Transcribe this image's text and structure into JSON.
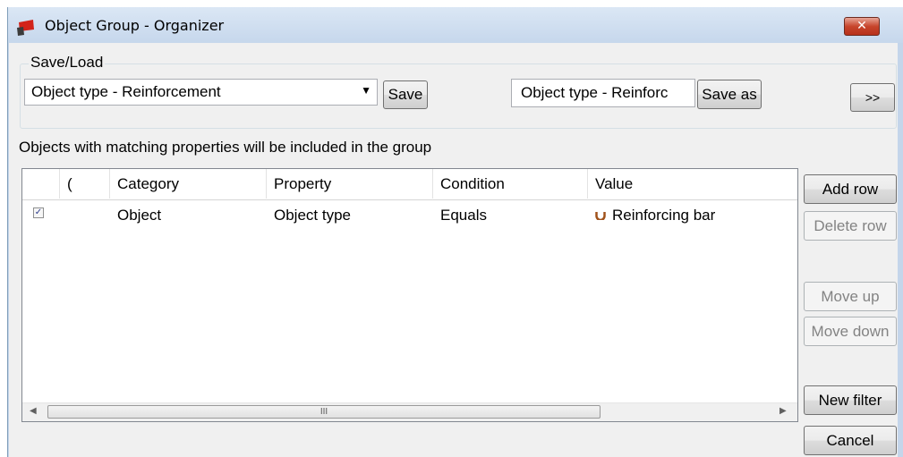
{
  "window": {
    "title": "Object Group - Organizer",
    "close_label": "✕"
  },
  "save_load": {
    "legend": "Save/Load",
    "combo_value": "Object type - Reinforcement",
    "save_label": "Save",
    "saveas_value": "Object type - Reinforc",
    "saveas_label": "Save as",
    "expand_label": ">>"
  },
  "caption": "Objects with matching properties will be included in the group",
  "grid": {
    "columns": [
      "",
      "(",
      "Category",
      "Property",
      "Condition",
      "Value"
    ],
    "rows": [
      {
        "checked": true,
        "paren": "",
        "category": "Object",
        "property": "Object type",
        "condition": "Equals",
        "value": "Reinforcing bar",
        "value_icon": "reinforcing-bar-icon"
      }
    ],
    "scroll_thumb_glyph": "III"
  },
  "side_buttons": {
    "add_row": "Add row",
    "delete_row": "Delete row",
    "move_up": "Move up",
    "move_down": "Move down",
    "new_filter": "New filter",
    "cancel": "Cancel"
  },
  "colors": {
    "accent_red": "#c8261a",
    "value_icon_color": "#a0521b"
  }
}
